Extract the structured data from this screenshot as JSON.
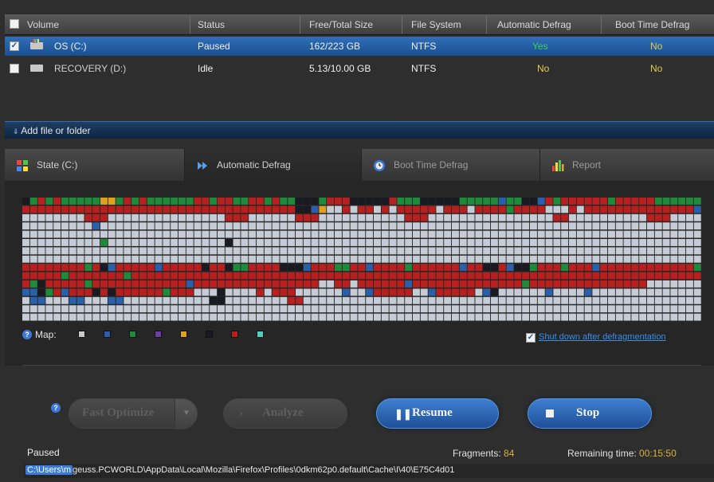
{
  "volume_table": {
    "headers": [
      "Volume",
      "Status",
      "Free/Total Size",
      "File System",
      "Automatic Defrag",
      "Boot Time Defrag"
    ],
    "rows": [
      {
        "name": "OS (C:)",
        "status": "Paused",
        "size": "162/223 GB",
        "fs": "NTFS",
        "auto_defrag": "Yes",
        "boot_defrag": "No",
        "checked": true,
        "selected": true
      },
      {
        "name": "RECOVERY (D:)",
        "status": "Idle",
        "size": "5.13/10.00 GB",
        "fs": "NTFS",
        "auto_defrag": "No",
        "boot_defrag": "No",
        "checked": false,
        "selected": false
      }
    ]
  },
  "add_file": {
    "label": "Add file or folder"
  },
  "tabs": [
    {
      "label": "State (C:)",
      "icon": "pie-chart-icon"
    },
    {
      "label": "Automatic Defrag",
      "icon": "fast-forward-icon"
    },
    {
      "label": "Boot Time Defrag",
      "icon": "clock-icon"
    },
    {
      "label": "Report",
      "icon": "bar-chart-icon"
    }
  ],
  "map": {
    "label": "Map:",
    "legend_colors": [
      "#c9c9c9",
      "#2a5faa",
      "#1f8a3a",
      "#6b3fa5",
      "#e0a020",
      "#1a1a22",
      "#b8201f",
      "#4fd0c0"
    ],
    "cell_colors": {
      "E": "#c6ccd6",
      "R": "#b8201f",
      "G": "#1f8a3a",
      "B": "#2a5faa",
      "K": "#1a1a22",
      "Y": "#e0a020"
    },
    "rows": [
      "KGRGRGGGGGYYGRGRGGGGGGRRGRRGGRRGRGGKKKGRRRKKKKKRGGGKKKKKGGGGGBGGKKBRGRRRRRRGRRRRRGGGGGG",
      "RRRRRRRRRRRRRRRRRRRRRRRRRRRRRRRRRRRKKBYEERERRERERRRRRERRRERRRRGRRRREEERERRRRRRRRRRRRRRB",
      "EEEEEEEERRREEEEEEEEEEEEEEERRREEEEEERRREEEEEEEEEEERRREEEEEEEEEEEEEEEERREEEEEEEEEERRREEEE",
      "EEEEEEEEEBEEEEEEEEEEEEEEEEEEEEEEEEEEEEEEEEEEEEEEEEEEEEEEEEEEEEEEEEEEEEEEEEEEEEEEEEEEEEEE",
      "EEEEEEEEEEEEEEEEEEEEEEEEEEEEEEEEEEEEEEEEEEEEEEEEEEEEEEEEEEEEEEEEEEEEEEEEEEEEEEEEEEEEEEEE",
      "EEEEEEEEEEGEEEEEEEEEEEEEEEKEEEEEEEEEEEEEEEEEEEEEEEEEEEEEEEEEEEEEEEEEEEEEEEEEEEEEEEEEEEEE",
      "EEEEEEEEEEEEEEEEEEEEEEEEEEEEEEEEEEEEEEEEEEEEEEEEEEEEEEEEEEEEEEEEEEEEEEEEEEEEEEEEEEEEEEEE",
      "EEEEEEEEEEEEEEEEEEEEEEEEEEEEEEEEEEEEEEEEEEEEEEEEEEEEEEEEEEEEEEEEEEEEEEEEEEEEEEEEEEEEEEEG",
      "RRRRRRRRGRKBRRRRRBRRRRRKRRKGGRRRRKKKBRRRGGRRBRRRRGRRRRRRBRRKKRBKKGRRRGRRRBRRRRRRRRRRRRGK",
      "RRRRRGRRRRRRRGRRRRRRRRRRRRRRRRRRRRRRRRRRRRRRRRRRRRRRRRRRRRRRRRRRRRRRRRRRRRRRRRRRRRRRRRR",
      "RGKRRRRRGRRRRRRRRRRRRBRRRRRRRRRRRRRRRREERRERRRRRRBRRRRRRRRRRRRRRGRRRRRRRRRRRRRRREEEEEEE",
      "BBKGRBRRRKRKRRRRRRGRRREEEKEEEERERRREEEEEEBEEBRRRRREEBRRRRREBKEEEEEEBEEEEBEEEEEEEEEEEEEE",
      "EBBEEEBBEEEBBEEEEEEEEEEEKKEEEEEEEERREEEEEEEEEEEEEEEEEEEEEEEEEEEEEEEEEEEEEEEEEEEEEEEEEEE",
      "EEEEEEEEEEEEEEEEEEEEEEEEEEEEEEEEEEEEEEEEEEEEEEEEEEEEEEEEEEEEEEEEEEEEEEEEEEEEEEEEEEEEEEE",
      "EEEEEEEEEEEEEEEEEEEEEEEEEEEEEEEEEEEEEEEEEEEEEEEEEEEEEEEEEEEEEEEEEEEEEEEEEEEEEEEEEEEEEEE"
    ]
  },
  "shutdown": {
    "label": "Shut down after defragmentation",
    "checked": true
  },
  "buttons": {
    "fast_optimize": "Fast Optimize",
    "analyze": "Analyze",
    "resume": "Resume",
    "stop": "Stop"
  },
  "status": {
    "state": "Paused",
    "fragments_label": "Fragments:",
    "fragments_value": "84",
    "remaining_label": "Remaining time:",
    "remaining_value": "00:15:50",
    "path_prefix": "C:\\Users\\m",
    "path_rest": "geuss.PCWORLD\\AppData\\Local\\Mozilla\\Firefox\\Profiles\\0dkm62p0.default\\Cache\\I\\40\\E75C4d01"
  }
}
